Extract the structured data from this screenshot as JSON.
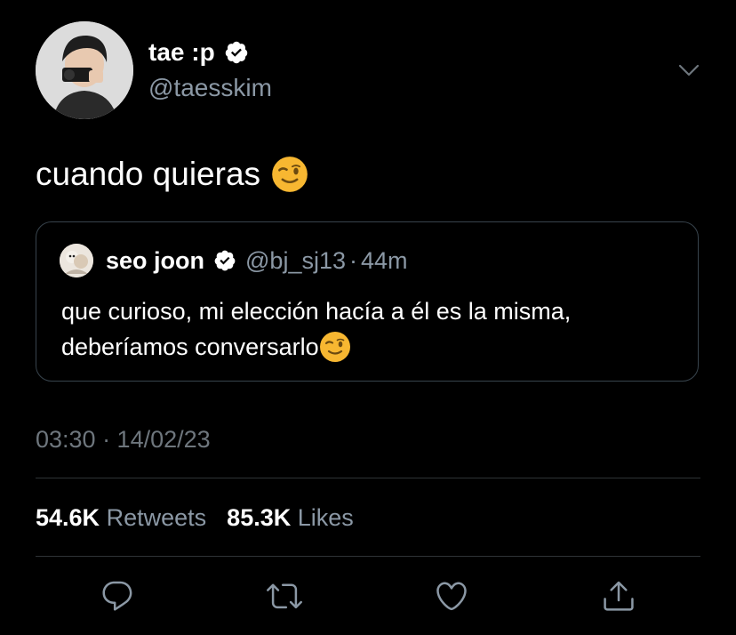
{
  "tweet": {
    "author": {
      "display_name": "tae :p",
      "handle": "@taesskim",
      "verified": true
    },
    "text": "cuando quieras",
    "text_emoji": "winking-face",
    "quoted": {
      "display_name": "seo joon",
      "handle": "@bj_sj13",
      "separator": "·",
      "time_ago": "44m",
      "verified": true,
      "text_line1": "que curioso, mi elección hacía a él es la misma,",
      "text_line2": "deberíamos conversarlo",
      "text_emoji": "winking-face"
    },
    "timestamp": "03:30 · 14/02/23",
    "retweets_count": "54.6K",
    "retweets_label": "Retweets",
    "likes_count": "85.3K",
    "likes_label": "Likes"
  },
  "icons": {
    "more": "chevron-down-icon",
    "reply": "reply-icon",
    "retweet": "retweet-icon",
    "like": "heart-icon",
    "share": "share-icon"
  },
  "colors": {
    "background": "#000000",
    "text_primary": "#ffffff",
    "text_secondary": "#8b98a5",
    "border": "#2f3336",
    "emoji": "#f7b731"
  }
}
